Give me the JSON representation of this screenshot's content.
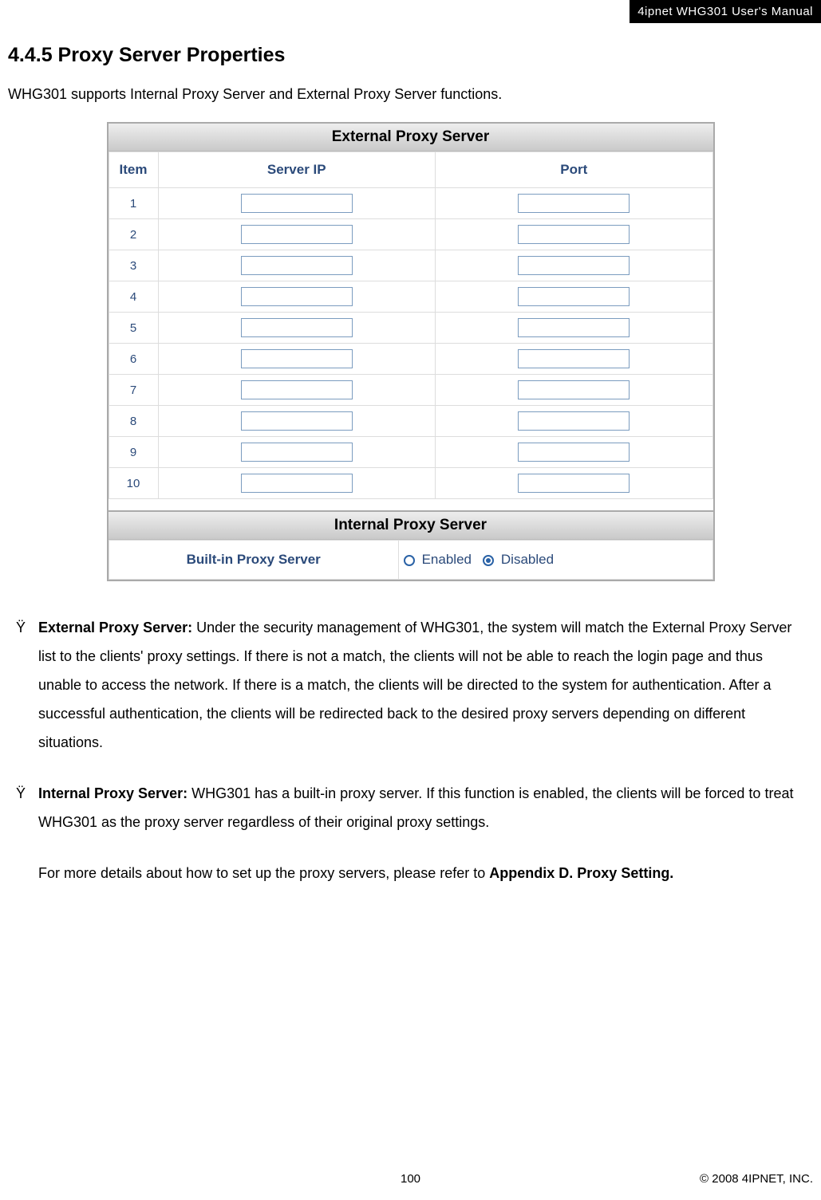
{
  "header": {
    "label": "4ipnet WHG301 User's Manual"
  },
  "section": {
    "number_title": "4.4.5 Proxy Server Properties",
    "intro": "WHG301 supports Internal Proxy Server and External Proxy Server functions."
  },
  "external_table": {
    "title": "External Proxy Server",
    "headers": {
      "item": "Item",
      "server_ip": "Server IP",
      "port": "Port"
    },
    "rows": [
      {
        "item": "1",
        "server_ip": "",
        "port": ""
      },
      {
        "item": "2",
        "server_ip": "",
        "port": ""
      },
      {
        "item": "3",
        "server_ip": "",
        "port": ""
      },
      {
        "item": "4",
        "server_ip": "",
        "port": ""
      },
      {
        "item": "5",
        "server_ip": "",
        "port": ""
      },
      {
        "item": "6",
        "server_ip": "",
        "port": ""
      },
      {
        "item": "7",
        "server_ip": "",
        "port": ""
      },
      {
        "item": "8",
        "server_ip": "",
        "port": ""
      },
      {
        "item": "9",
        "server_ip": "",
        "port": ""
      },
      {
        "item": "10",
        "server_ip": "",
        "port": ""
      }
    ]
  },
  "internal_table": {
    "title": "Internal Proxy Server",
    "label": "Built-in Proxy Server",
    "enabled_label": "Enabled",
    "disabled_label": "Disabled",
    "selected": "disabled"
  },
  "bullet_marker": "Ÿ",
  "bullets": {
    "ext": {
      "bold": "External Proxy Server:",
      "text": " Under the security management of WHG301, the system will match the External Proxy Server list to the clients' proxy settings. If there is not a match, the clients will not be able to reach the login page and thus unable to access the network. If there is a match, the clients will be directed to the system for authentication. After a successful authentication, the clients will be redirected back to the desired proxy servers depending on different situations."
    },
    "int": {
      "bold": "Internal Proxy Server:",
      "text": " WHG301 has a built-in proxy server. If this function is enabled, the clients will be forced to treat WHG301 as the proxy server regardless of their original proxy settings."
    }
  },
  "appendix": {
    "pre": "For more details about how to set up the proxy servers, please refer to ",
    "bold": "Appendix D. Proxy Setting."
  },
  "footer": {
    "page": "100",
    "copyright": "© 2008 4IPNET, INC."
  }
}
